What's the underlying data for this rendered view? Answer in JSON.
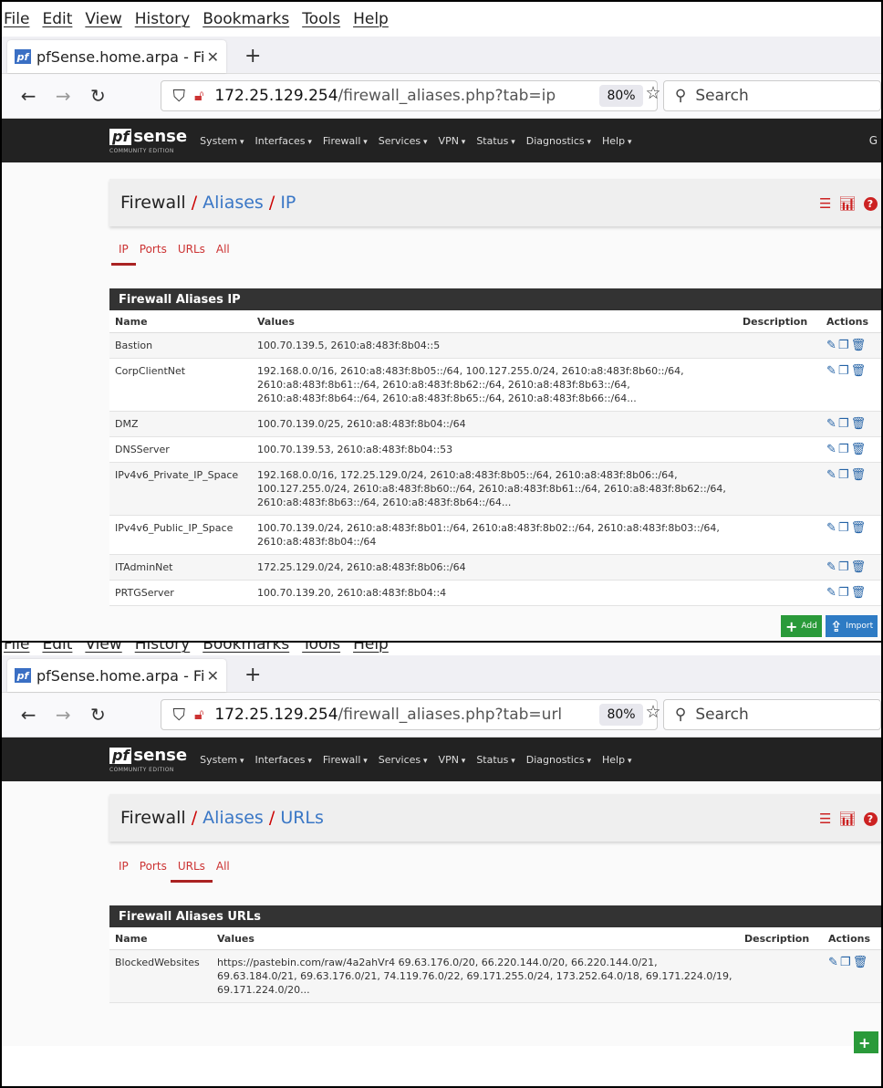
{
  "menubar": [
    "File",
    "Edit",
    "View",
    "History",
    "Bookmarks",
    "Tools",
    "Help"
  ],
  "browser": {
    "tab_title": "pfSense.home.arpa - Fire",
    "favicon": "pf",
    "search_placeholder": "Search",
    "zoom": "80%"
  },
  "pfsense": {
    "logo_pf": "pf",
    "logo_sense": "sense",
    "logo_sub": "COMMUNITY EDITION",
    "menu": [
      "System",
      "Interfaces",
      "Firewall",
      "Services",
      "VPN",
      "Status",
      "Diagnostics",
      "Help"
    ],
    "right_cut": "G"
  },
  "subtabs": [
    "IP",
    "Ports",
    "URLs",
    "All"
  ],
  "columns": {
    "name": "Name",
    "values": "Values",
    "description": "Description",
    "actions": "Actions"
  },
  "shot1": {
    "url_host": "172.25.129.254",
    "url_path": "/firewall_aliases.php?tab=ip",
    "breadcrumb": [
      "Firewall",
      "Aliases",
      "IP"
    ],
    "table_title": "Firewall Aliases IP",
    "rows": [
      {
        "name": "Bastion",
        "values": "100.70.139.5, 2610:a8:483f:8b04::5"
      },
      {
        "name": "CorpClientNet",
        "values": "192.168.0.0/16, 2610:a8:483f:8b05::/64, 100.127.255.0/24, 2610:a8:483f:8b60::/64, 2610:a8:483f:8b61::/64, 2610:a8:483f:8b62::/64, 2610:a8:483f:8b63::/64, 2610:a8:483f:8b64::/64, 2610:a8:483f:8b65::/64, 2610:a8:483f:8b66::/64..."
      },
      {
        "name": "DMZ",
        "values": "100.70.139.0/25, 2610:a8:483f:8b04::/64"
      },
      {
        "name": "DNSServer",
        "values": "100.70.139.53, 2610:a8:483f:8b04::53"
      },
      {
        "name": "IPv4v6_Private_IP_Space",
        "values": "192.168.0.0/16, 172.25.129.0/24, 2610:a8:483f:8b05::/64, 2610:a8:483f:8b06::/64, 100.127.255.0/24, 2610:a8:483f:8b60::/64, 2610:a8:483f:8b61::/64, 2610:a8:483f:8b62::/64, 2610:a8:483f:8b63::/64, 2610:a8:483f:8b64::/64..."
      },
      {
        "name": "IPv4v6_Public_IP_Space",
        "values": "100.70.139.0/24, 2610:a8:483f:8b01::/64, 2610:a8:483f:8b02::/64, 2610:a8:483f:8b03::/64, 2610:a8:483f:8b04::/64"
      },
      {
        "name": "ITAdminNet",
        "values": "172.25.129.0/24, 2610:a8:483f:8b06::/64"
      },
      {
        "name": "PRTGServer",
        "values": "100.70.139.20, 2610:a8:483f:8b04::4"
      }
    ],
    "btn_add": "Add",
    "btn_import": "Import"
  },
  "shot2": {
    "url_host": "172.25.129.254",
    "url_path": "/firewall_aliases.php?tab=url",
    "breadcrumb": [
      "Firewall",
      "Aliases",
      "URLs"
    ],
    "table_title": "Firewall Aliases URLs",
    "rows": [
      {
        "name": "BlockedWebsites",
        "values": "https://pastebin.com/raw/4a2ahVr4 69.63.176.0/20, 66.220.144.0/20, 66.220.144.0/21, 69.63.184.0/21, 69.63.176.0/21, 74.119.76.0/22, 69.171.255.0/24, 173.252.64.0/18, 69.171.224.0/19, 69.171.224.0/20..."
      }
    ]
  },
  "colors": {
    "pf_dark": "#222222",
    "accent_red": "#c33333",
    "link_blue": "#3a77c6",
    "add_green": "#2a9a3a",
    "import_blue": "#2e7bc4"
  }
}
